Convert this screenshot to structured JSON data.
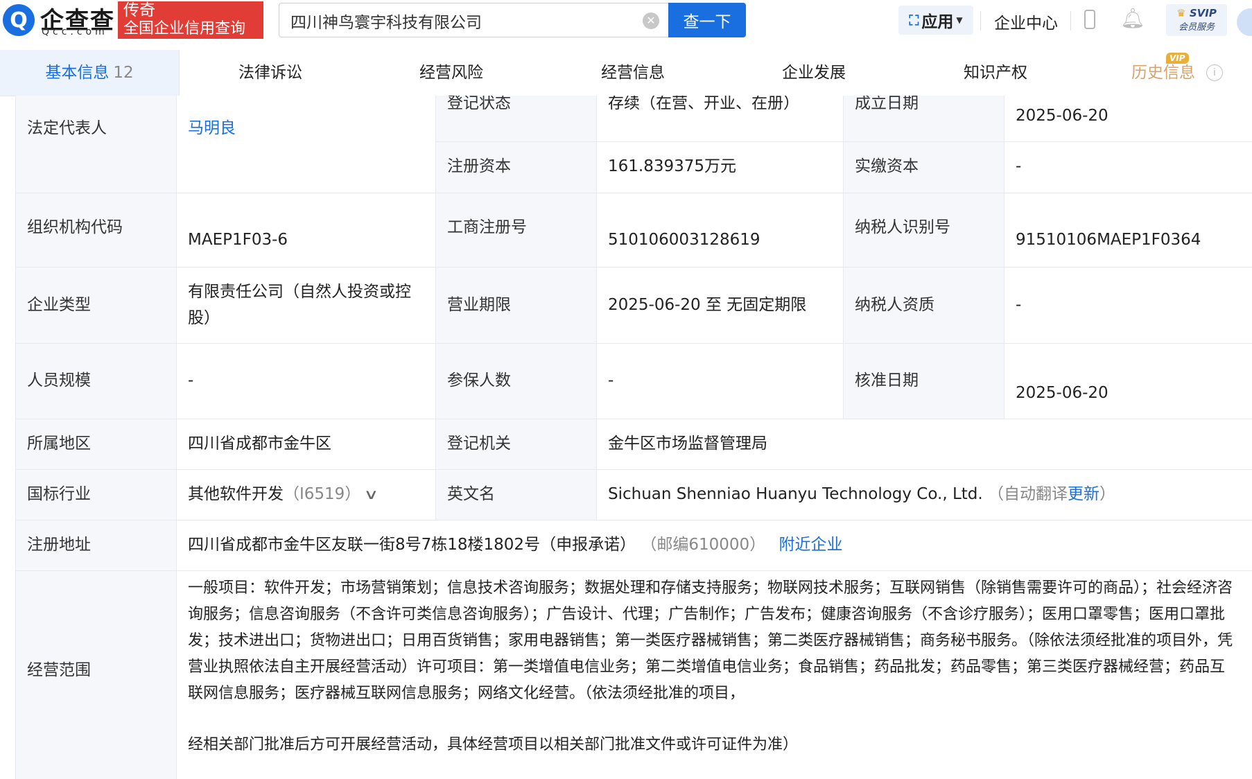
{
  "header": {
    "logo_cn": "企查查",
    "logo_en": "Qcc.com",
    "slogan_line1": "传奇",
    "slogan_line2": "全国企业信用查询",
    "search_value": "四川神鸟寰宇科技有限公司",
    "search_button": "查一下",
    "apps_label": "应用",
    "enterprise_center": "企业中心",
    "vip_line1": "SVIP",
    "vip_line2": "会员服务"
  },
  "tabs": {
    "basic": "基本信息",
    "basic_count": "12",
    "legal": "法律诉讼",
    "risk": "经营风险",
    "business": "经营信息",
    "development": "企业发展",
    "ip": "知识产权",
    "history": "历史信息",
    "history_tag": "VIP"
  },
  "table": {
    "legal_rep_label": "法定代表人",
    "legal_rep_value": "马明良",
    "reg_status_label": "登记状态",
    "reg_status_value": "存续（在营、开业、在册）",
    "found_date_label": "成立日期",
    "found_date_value": "2025-06-20",
    "reg_capital_label": "注册资本",
    "reg_capital_value": "161.839375万元",
    "paid_capital_label": "实缴资本",
    "paid_capital_value": "-",
    "org_code_label": "组织机构代码",
    "org_code_value": "MAEP1F03-6",
    "biz_reg_no_label": "工商注册号",
    "biz_reg_no_value": "510106003128619",
    "taxpayer_id_label": "纳税人识别号",
    "taxpayer_id_value": "91510106MAEP1F0364",
    "ent_type_label": "企业类型",
    "ent_type_value": "有限责任公司（自然人投资或控股）",
    "biz_term_label": "营业期限",
    "biz_term_value": "2025-06-20 至 无固定期限",
    "taxpayer_qual_label": "纳税人资质",
    "taxpayer_qual_value": "-",
    "staff_size_label": "人员规模",
    "staff_size_value": "-",
    "insured_label": "参保人数",
    "insured_value": "-",
    "approve_date_label": "核准日期",
    "approve_date_value": "2025-06-20",
    "region_label": "所属地区",
    "region_value": "四川省成都市金牛区",
    "reg_authority_label": "登记机关",
    "reg_authority_value": "金牛区市场监督管理局",
    "industry_label": "国标行业",
    "industry_value": "其他软件开发",
    "industry_code": "（I6519）",
    "english_name_label": "英文名",
    "english_name_value": "Sichuan Shenniao Huanyu Technology Co., Ltd.",
    "translate_prefix": "（自动翻译",
    "translate_link": "更新",
    "translate_suffix": "）",
    "address_label": "注册地址",
    "address_value": "四川省成都市金牛区友联一街8号7栋18楼1802号（申报承诺）",
    "postcode": "（邮编610000）",
    "nearby_link": "附近企业",
    "scope_label": "经营范围",
    "scope_value": "一般项目：软件开发；市场营销策划；信息技术咨询服务；数据处理和存储支持服务；物联网技术服务；互联网销售（除销售需要许可的商品）；社会经济咨询服务；信息咨询服务（不含许可类信息咨询服务）；广告设计、代理；广告制作；广告发布；健康咨询服务（不含诊疗服务）；医用口罩零售；医用口罩批发；技术进出口；货物进出口；日用百货销售；家用电器销售；第一类医疗器械销售；第二类医疗器械销售；商务秘书服务。（除依法须经批准的项目外，凭营业执照依法自主开展经营活动）许可项目：第一类增值电信业务；第二类增值电信业务；食品销售；药品批发；药品零售；第三类医疗器械经营；药品互联网信息服务；医疗器械互联网信息服务；网络文化经营。（依法须经批准的项目，",
    "scope_value_tail": "经相关部门批准后方可开展经营活动，具体经营项目以相关部门批准文件或许可证件为准）"
  },
  "colors": {
    "brand_blue": "#1a6fe0",
    "slogan_red": "#e23c37",
    "label_bg": "#f5f7fa",
    "history_gold": "#d8a36a"
  }
}
